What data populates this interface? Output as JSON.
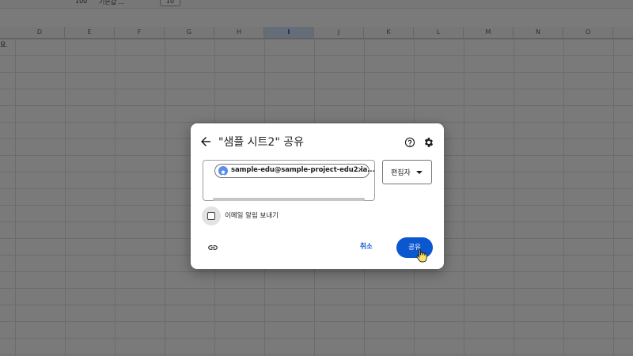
{
  "toolbar": {
    "zoom": "100",
    "font": "기본값 ...",
    "font_size": "10"
  },
  "sheet": {
    "columns": [
      "D",
      "E",
      "F",
      "G",
      "H",
      "I",
      "J",
      "K",
      "L",
      "M",
      "N",
      "O"
    ],
    "selected_column": "I",
    "cell_partial": "요."
  },
  "dialog": {
    "title": "\"샘플 시트2\" 공유",
    "recipient_chip": "sample-edu@sample-project-edu2.ia...",
    "role_label": "편집자",
    "notify_label": "이메일 알림 보내기",
    "notify_checked": false,
    "cancel_label": "취소",
    "share_label": "공유"
  },
  "colors": {
    "accent": "#0b57d0",
    "overlay": "rgba(0,0,0,0.52)"
  },
  "icons": [
    "back-arrow-icon",
    "help-icon",
    "gear-icon",
    "avatar-icon",
    "close-icon",
    "dropdown-caret-icon",
    "link-icon",
    "hand-cursor-icon"
  ]
}
